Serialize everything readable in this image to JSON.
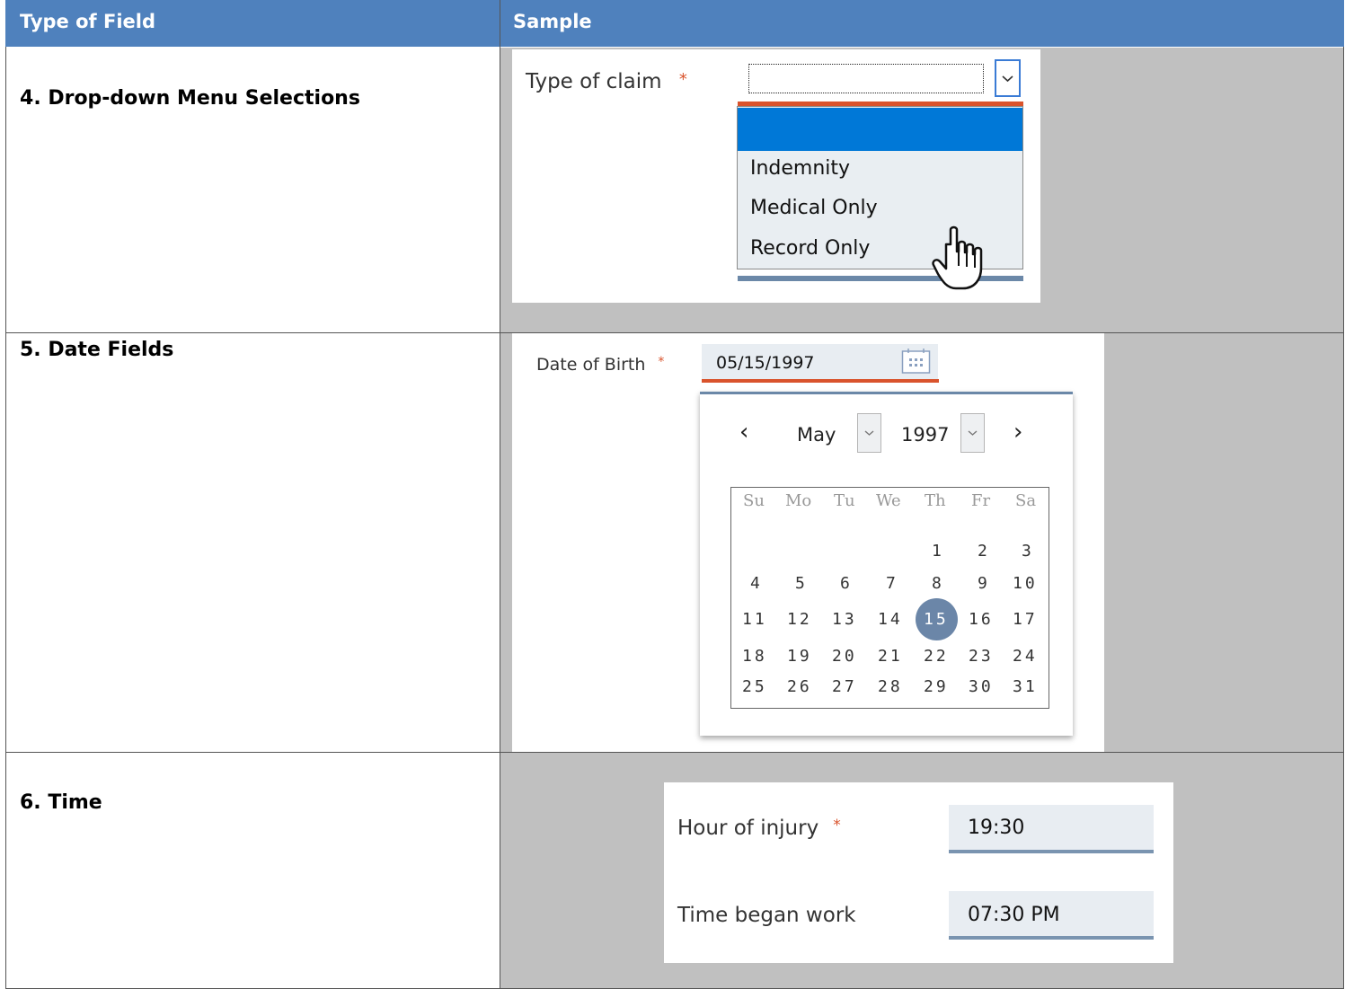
{
  "header": {
    "col1": "Type of Field",
    "col2": "Sample"
  },
  "rows": {
    "dropdown": {
      "field_label_num": "4",
      "field_label_text": ". Drop-down Menu Selections",
      "sample_label": "Type of claim",
      "required_mark": "*",
      "options": [
        "Indemnity",
        "Medical Only",
        "Record Only"
      ],
      "cursor_icon": "hand-pointer-icon"
    },
    "date": {
      "field_label": "5. Date Fields",
      "sample_label": "Date of Birth",
      "required_mark": "*",
      "value": "05/15/1997",
      "calendar": {
        "month": "May",
        "year": "1997",
        "prev": "‹",
        "next": "›",
        "weekdays": [
          "Su",
          "Mo",
          "Tu",
          "We",
          "Th",
          "Fr",
          "Sa"
        ],
        "days": [
          "1",
          "2",
          "3",
          "4",
          "5",
          "6",
          "7",
          "8",
          "9",
          "10",
          "11",
          "12",
          "13",
          "14",
          "15",
          "16",
          "17",
          "18",
          "19",
          "20",
          "21",
          "22",
          "23",
          "24",
          "25",
          "26",
          "27",
          "28",
          "29",
          "30",
          "31"
        ],
        "selected_day": "15"
      }
    },
    "time": {
      "field_label": "6. Time",
      "hour_label": "Hour of injury",
      "required_mark": "*",
      "hour_value": "19:30",
      "began_label": "Time began work",
      "began_value": "07:30 PM"
    }
  }
}
